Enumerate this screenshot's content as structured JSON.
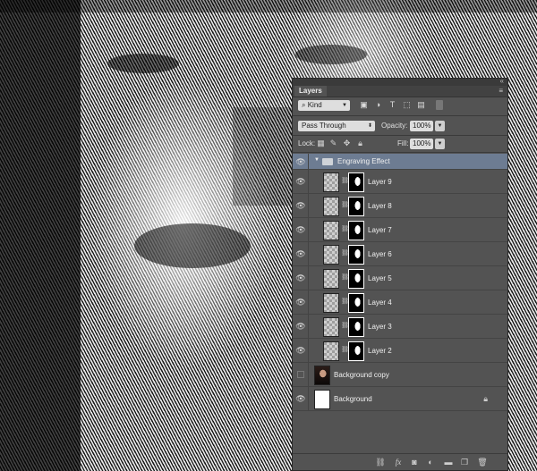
{
  "panel": {
    "tab_label": "Layers",
    "collapse_glyph": "«",
    "menu_glyph": "≡"
  },
  "filter": {
    "kind_label": "Kind",
    "icons": [
      "pixel-filter-icon",
      "adjustment-filter-icon",
      "type-filter-icon",
      "shape-filter-icon",
      "smart-object-filter-icon",
      "filter-toggle-icon"
    ]
  },
  "blend": {
    "mode": "Pass Through",
    "opacity_label": "Opacity:",
    "opacity_value": "100%"
  },
  "lock": {
    "lock_label": "Lock:",
    "fill_label": "Fill:",
    "fill_value": "100%"
  },
  "layers": [
    {
      "name": "Engraving Effect",
      "type": "group",
      "visible": true,
      "selected": true
    },
    {
      "name": "Layer 9",
      "type": "layer",
      "visible": true
    },
    {
      "name": "Layer 8",
      "type": "layer",
      "visible": true
    },
    {
      "name": "Layer 7",
      "type": "layer",
      "visible": true
    },
    {
      "name": "Layer 6",
      "type": "layer",
      "visible": true
    },
    {
      "name": "Layer 5",
      "type": "layer",
      "visible": true
    },
    {
      "name": "Layer 4",
      "type": "layer",
      "visible": true
    },
    {
      "name": "Layer 3",
      "type": "layer",
      "visible": true
    },
    {
      "name": "Layer 2",
      "type": "layer",
      "visible": true
    },
    {
      "name": "Background copy",
      "type": "photo",
      "visible": false
    },
    {
      "name": "Background",
      "type": "background",
      "visible": true,
      "locked": true
    }
  ],
  "toolbar_icons": [
    "link-layers-icon",
    "fx-icon",
    "add-mask-icon",
    "adjustment-layer-icon",
    "new-group-icon",
    "new-layer-icon",
    "delete-layer-icon"
  ],
  "colors": {
    "panel_bg": "#535353",
    "selected_row": "#6d7c92"
  }
}
